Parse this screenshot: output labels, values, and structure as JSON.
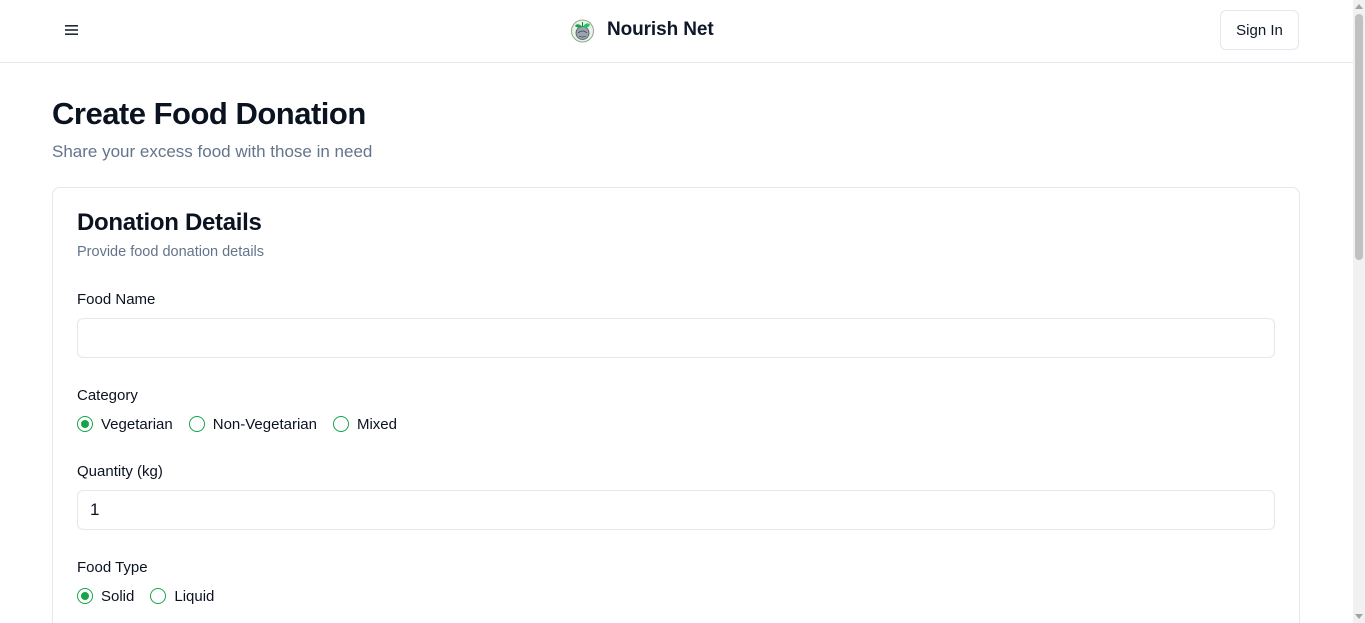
{
  "header": {
    "menu_icon": "hamburger-menu-icon",
    "brand_name": "Nourish Net",
    "logo_icon": "leaf-globe-logo-icon",
    "sign_in_label": "Sign In"
  },
  "page": {
    "title": "Create Food Donation",
    "subtitle": "Share your excess food with those in need"
  },
  "card": {
    "title": "Donation Details",
    "subtitle": "Provide food donation details",
    "food_name": {
      "label": "Food Name",
      "value": "",
      "placeholder": ""
    },
    "category": {
      "label": "Category",
      "options": [
        "Vegetarian",
        "Non-Vegetarian",
        "Mixed"
      ],
      "selected": "Vegetarian"
    },
    "quantity": {
      "label": "Quantity (kg)",
      "value": "1"
    },
    "food_type": {
      "label": "Food Type",
      "options": [
        "Solid",
        "Liquid"
      ],
      "selected": "Solid"
    }
  },
  "colors": {
    "accent": "#16a34a",
    "muted_text": "#64748b",
    "border": "#e2e8f0"
  }
}
